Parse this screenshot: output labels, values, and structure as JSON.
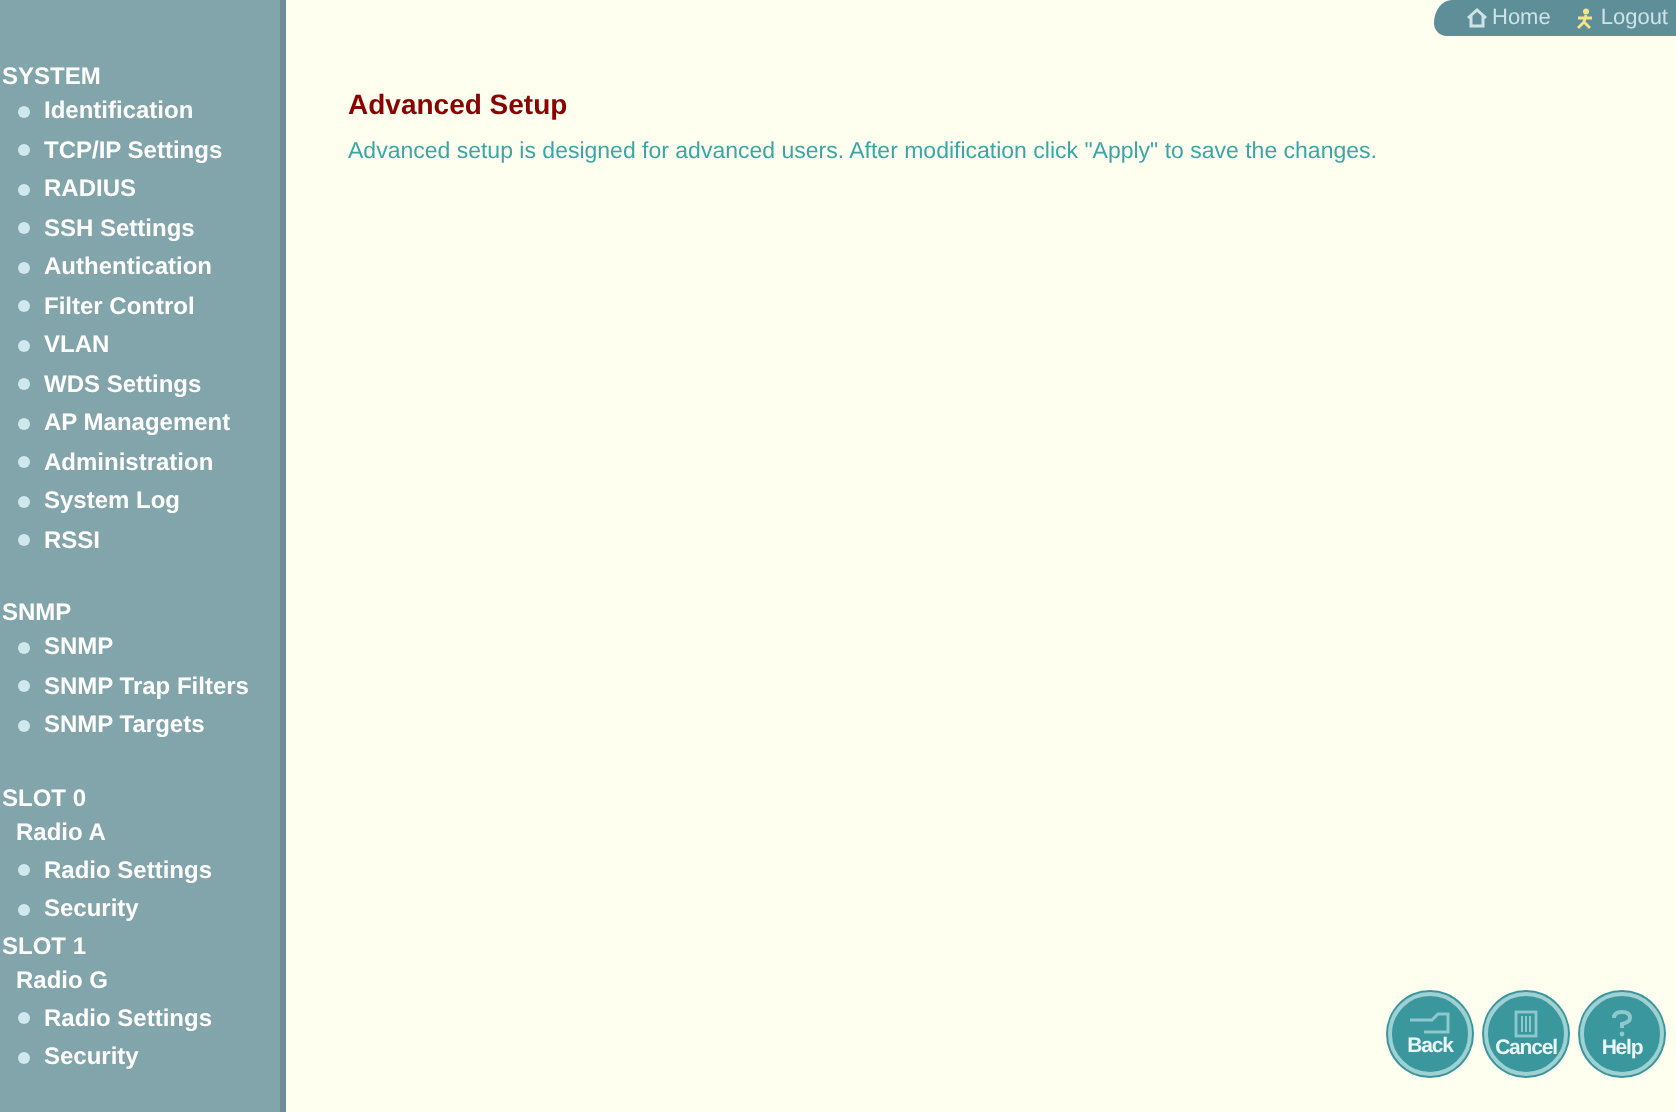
{
  "top_links": [
    {
      "label": "Home",
      "kind": "home"
    },
    {
      "label": "Logout",
      "kind": "logout"
    }
  ],
  "sidebar": {
    "sections": [
      {
        "title": "SYSTEM",
        "kind": "group",
        "items": [
          {
            "label": "Identification"
          },
          {
            "label": "TCP/IP Settings"
          },
          {
            "label": "RADIUS"
          },
          {
            "label": "SSH Settings"
          },
          {
            "label": "Authentication"
          },
          {
            "label": "Filter Control"
          },
          {
            "label": "VLAN"
          },
          {
            "label": "WDS Settings"
          },
          {
            "label": "AP Management"
          },
          {
            "label": "Administration"
          },
          {
            "label": "System Log"
          },
          {
            "label": "RSSI"
          }
        ]
      },
      {
        "title": "SNMP",
        "kind": "group",
        "items": [
          {
            "label": "SNMP"
          },
          {
            "label": "SNMP Trap Filters"
          },
          {
            "label": "SNMP Targets"
          }
        ]
      },
      {
        "title": "SLOT 0",
        "kind": "slot",
        "subtitle": "Radio A",
        "items": [
          {
            "label": "Radio Settings"
          },
          {
            "label": "Security"
          }
        ]
      },
      {
        "title": "SLOT 1",
        "kind": "slot",
        "subtitle": "Radio G",
        "items": [
          {
            "label": "Radio Settings"
          },
          {
            "label": "Security"
          }
        ]
      }
    ]
  },
  "main": {
    "title": "Advanced Setup",
    "description": "Advanced setup is designed for advanced users. After modification click \"Apply\" to save the changes."
  },
  "buttons": [
    {
      "label": "Back",
      "kind": "back"
    },
    {
      "label": "Cancel",
      "kind": "cancel"
    },
    {
      "label": "Help",
      "kind": "help"
    }
  ]
}
